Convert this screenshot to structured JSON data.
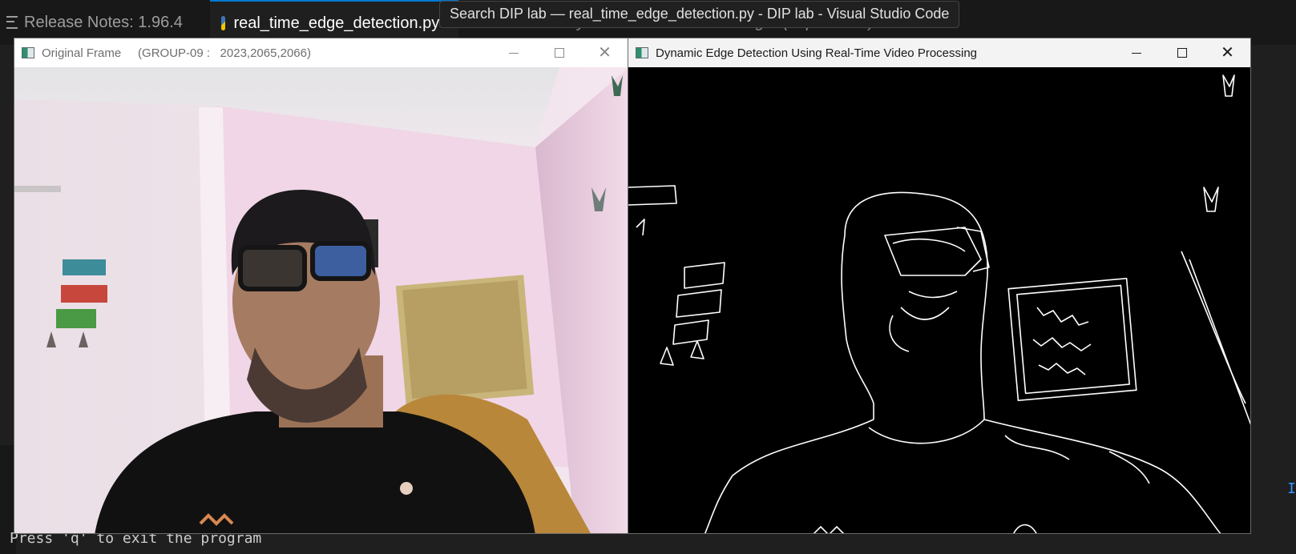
{
  "vscode": {
    "tabs": [
      {
        "label": "Release Notes: 1.96.4"
      },
      {
        "label": "real_time_edge_detection.py",
        "close": "×"
      },
      {
        "label": "Extension: Python Environment Manager (deprecated)"
      }
    ],
    "tooltip": "Search DIP lab — real_time_edge_detection.py - DIP lab - Visual Studio Code",
    "terminal_line": "Press 'q' to exit the program",
    "right_edge_text": "I",
    "accent_color": "#0078d4"
  },
  "windows": {
    "original": {
      "title": "Original Frame     (GROUP-09 :   2023,2065,2066)",
      "frame_label": "Webcam frame: person with glasses in a pink room"
    },
    "edges": {
      "title": "Dynamic Edge Detection Using Real-Time Video Processing",
      "frame_label": "Canny edge map of the webcam frame"
    }
  },
  "icons": {
    "minimize": "minimize-icon",
    "maximize": "maximize-icon",
    "close": "close-icon",
    "app": "opencv-window-icon",
    "python": "python-file-icon",
    "notes": "release-notes-icon"
  }
}
